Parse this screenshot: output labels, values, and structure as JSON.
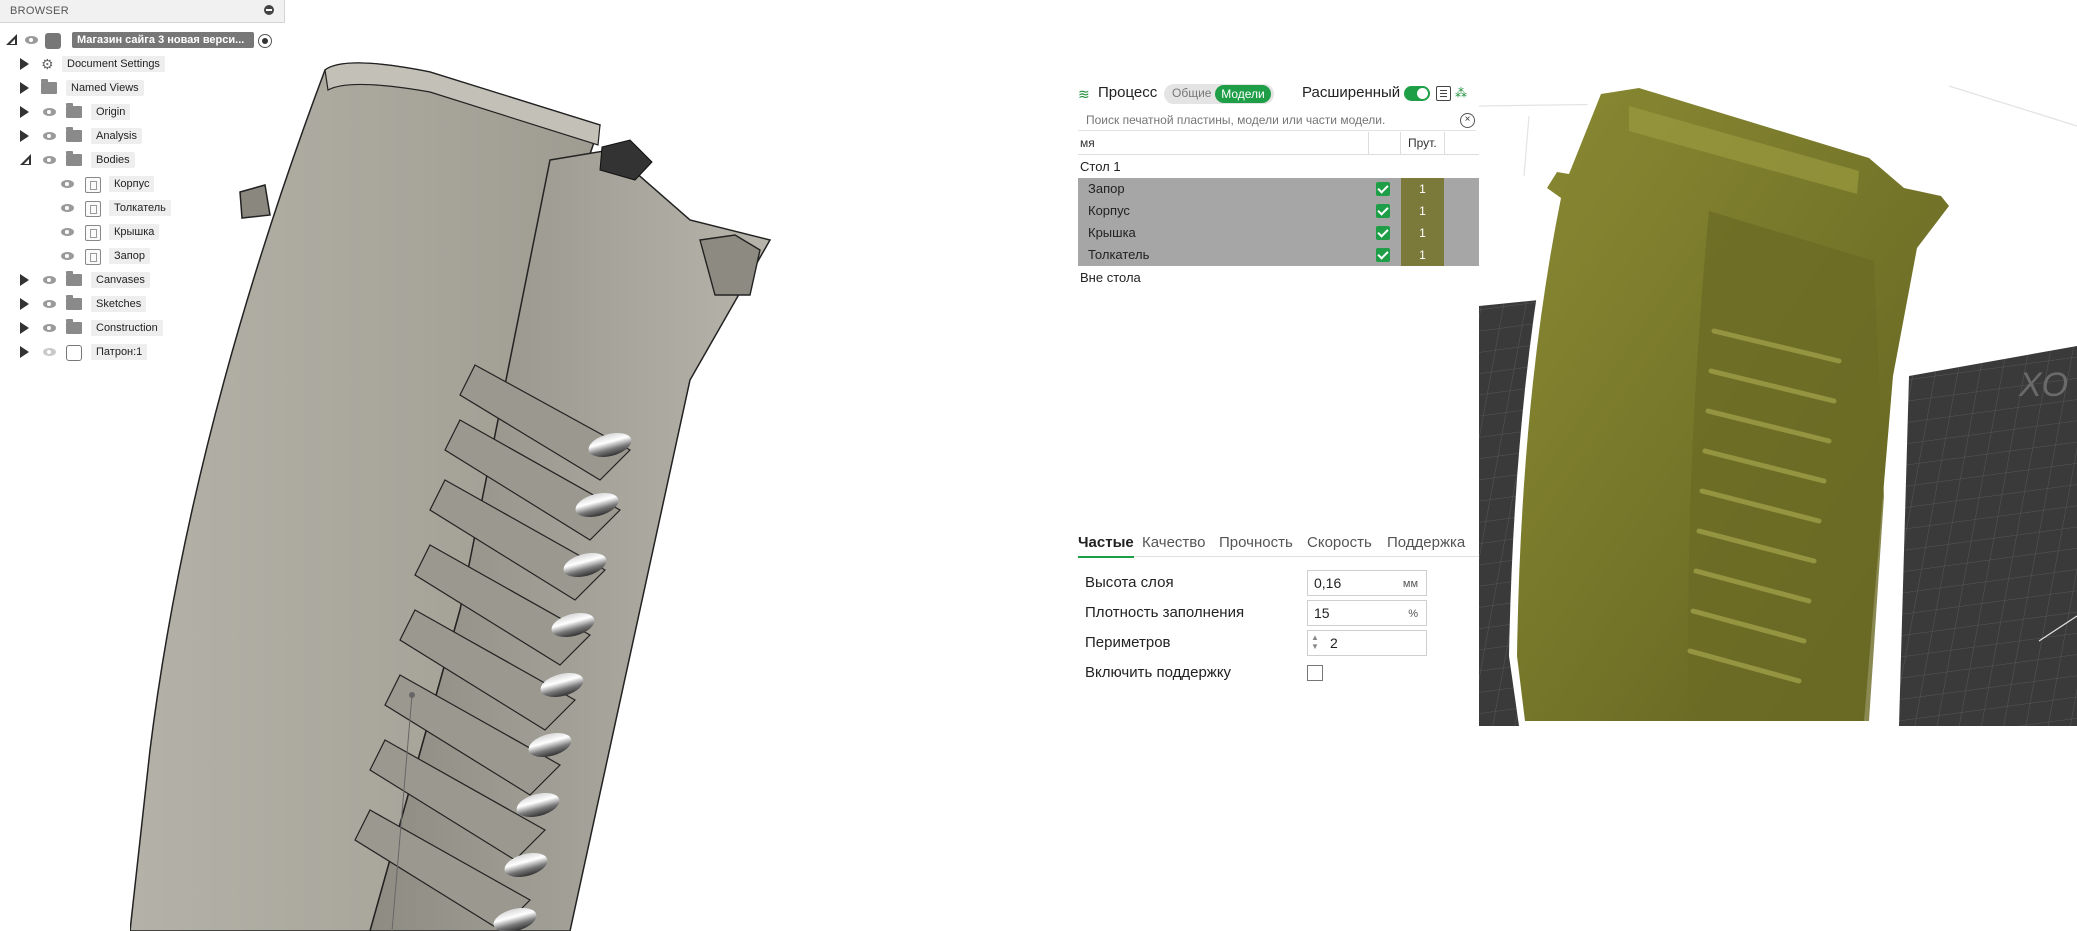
{
  "browser": {
    "header_title": "BROWSER",
    "root_label": "Магазин сайга 3 новая верси...",
    "items": [
      {
        "label": "Document Settings"
      },
      {
        "label": "Named Views"
      },
      {
        "label": "Origin"
      },
      {
        "label": "Analysis"
      },
      {
        "label": "Bodies"
      },
      {
        "label": "Корпус"
      },
      {
        "label": "Толкатель"
      },
      {
        "label": "Крышка"
      },
      {
        "label": "Запор"
      },
      {
        "label": "Canvases"
      },
      {
        "label": "Sketches"
      },
      {
        "label": "Construction"
      },
      {
        "label": "Патрон:1"
      }
    ]
  },
  "slicer": {
    "process_title": "Процесс",
    "seg_general": "Общие",
    "seg_models": "Модели",
    "advanced_label": "Расширенный",
    "advanced_on": true,
    "search_placeholder": "Поиск печатной пластины, модели или части модели.",
    "col_name": "мя",
    "col_count": "Прут.",
    "plate_label": "Стол 1",
    "objects": [
      {
        "name": "Запор",
        "count": "1",
        "enabled": true
      },
      {
        "name": "Корпус",
        "count": "1",
        "enabled": true
      },
      {
        "name": "Крышка",
        "count": "1",
        "enabled": true
      },
      {
        "name": "Толкатель",
        "count": "1",
        "enabled": true
      }
    ],
    "outside_label": "Вне стола",
    "tabs": [
      "Частые",
      "Качество",
      "Прочность",
      "Скорость",
      "Поддержка"
    ],
    "active_tab": "Частые",
    "settings": {
      "layer_height_label": "Высота слоя",
      "layer_height_value": "0,16",
      "layer_height_unit": "мм",
      "infill_label": "Плотность заполнения",
      "infill_value": "15",
      "infill_unit": "%",
      "perimeters_label": "Периметров",
      "perimeters_value": "2",
      "support_label": "Включить поддержку",
      "support_enabled": false
    },
    "bed_text": "XO"
  },
  "colors": {
    "accent_green": "#1e9e47",
    "model_olive": "#7a7a2c",
    "cad_gray": "#a7a59a",
    "selected_row": "#a6a6a6"
  }
}
